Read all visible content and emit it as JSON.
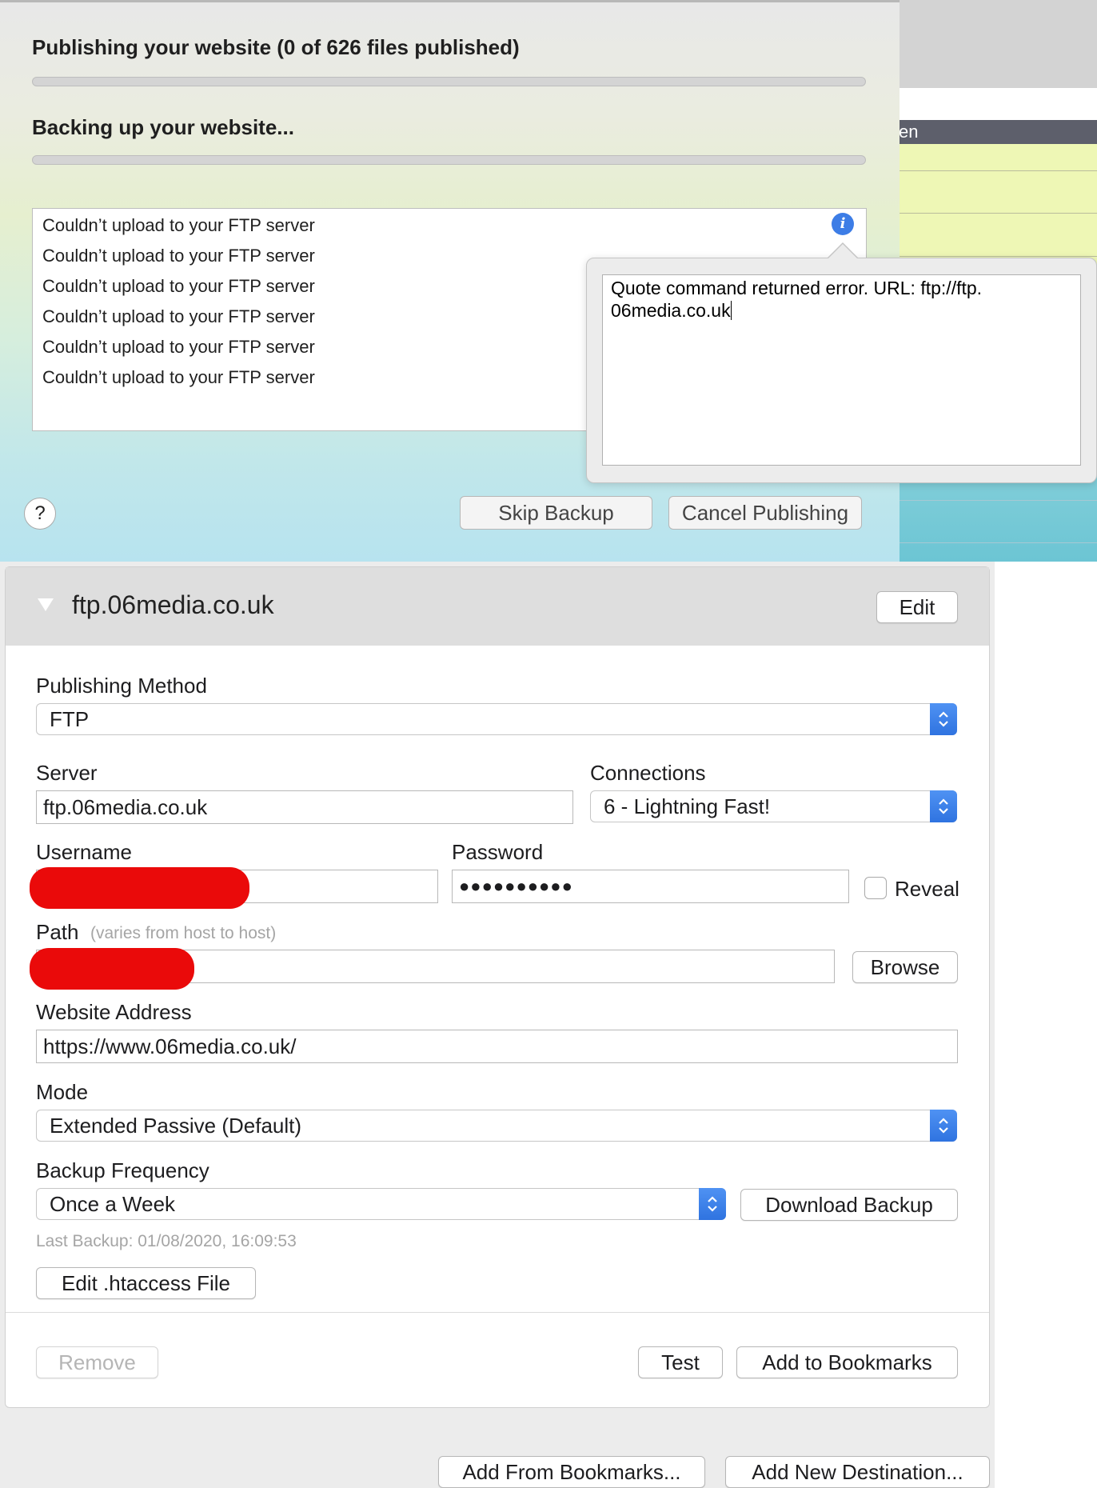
{
  "background_window": {
    "header_fragment": "en"
  },
  "sheet": {
    "publishing_title": "Publishing your website (0 of 626 files published)",
    "backup_title": "Backing up your website...",
    "log_lines": [
      "Couldn’t upload to your FTP server",
      "Couldn’t upload to your FTP server",
      "Couldn’t upload to your FTP server",
      "Couldn’t upload to your FTP server",
      "Couldn’t upload to your FTP server",
      "Couldn’t upload to your FTP server"
    ],
    "info_glyph": "i",
    "help_glyph": "?",
    "skip_backup_label": "Skip Backup",
    "cancel_publishing_label": "Cancel Publishing",
    "publishing_progress": 0,
    "backup_progress": 0
  },
  "popover": {
    "line1": "Quote command returned error. URL: ftp://ftp.",
    "line2": "06media.co.uk"
  },
  "destination": {
    "title": "ftp.06media.co.uk",
    "edit_label": "Edit",
    "publishing_method_label": "Publishing Method",
    "publishing_method_value": "FTP",
    "server_label": "Server",
    "server_value": "ftp.06media.co.uk",
    "connections_label": "Connections",
    "connections_value": "6 - Lightning Fast!",
    "username_label": "Username",
    "password_label": "Password",
    "password_value": "●●●●●●●●●●",
    "reveal_label": "Reveal",
    "path_label": "Path",
    "path_hint": "(varies from host to host)",
    "browse_label": "Browse",
    "website_address_label": "Website Address",
    "website_address_value": "https://www.06media.co.uk/",
    "mode_label": "Mode",
    "mode_value": "Extended Passive (Default)",
    "backup_frequency_label": "Backup Frequency",
    "backup_frequency_value": "Once a Week",
    "download_backup_label": "Download Backup",
    "last_backup": "Last Backup: 01/08/2020, 16:09:53",
    "edit_htaccess_label": "Edit .htaccess File",
    "remove_label": "Remove",
    "test_label": "Test",
    "add_bookmarks_label": "Add to Bookmarks"
  },
  "footer": {
    "add_from_bookmarks_label": "Add From Bookmarks...",
    "add_new_destination_label": "Add New Destination..."
  },
  "colors": {
    "accent": "#3478f6",
    "redaction": "#ea0a0a",
    "background_header": "#5d5f6b",
    "background_highlight": "#eef7b5"
  }
}
